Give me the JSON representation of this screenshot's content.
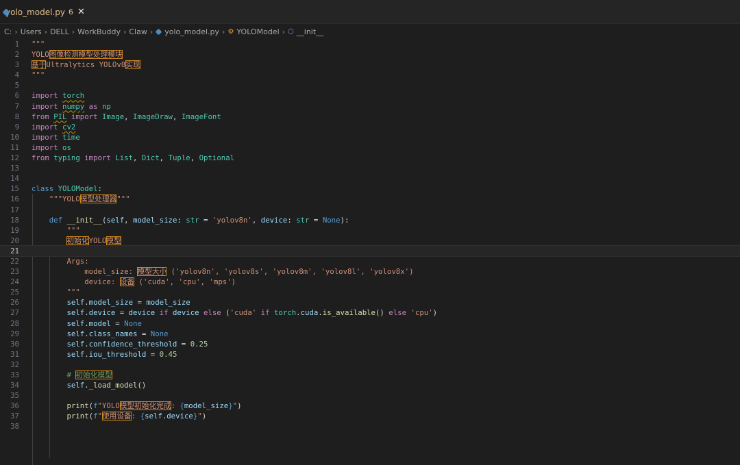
{
  "tab": {
    "filename": "yolo_model.py",
    "problem_count": "6",
    "close_glyph": "✕",
    "icon": "python-file-icon"
  },
  "breadcrumb": {
    "drive": "C:",
    "parts": [
      "Users",
      "DELL",
      "WorkBuddy",
      "Claw"
    ],
    "file": "yolo_model.py",
    "class_name": "YOLOModel",
    "method": "__init__"
  },
  "colors": {
    "keyword": "#c586c0",
    "builtin_keyword": "#569cd6",
    "function": "#dcdcaa",
    "class": "#4ec9b0",
    "string": "#ce9178",
    "number": "#b5cea8",
    "variable": "#9cdcfe",
    "comment": "#6a9955",
    "highlight_box": "#d18616"
  },
  "current_line": 21,
  "lines": [
    [
      [
        "str",
        "\"\"\""
      ]
    ],
    [
      [
        "str",
        "YOLO"
      ],
      [
        "str cjk",
        "图像检测模型处理模块"
      ]
    ],
    [
      [
        "str cjk",
        "基于"
      ],
      [
        "str",
        "Ultralytics YOLOv8"
      ],
      [
        "str cjk",
        "实现"
      ]
    ],
    [
      [
        "str",
        "\"\"\""
      ]
    ],
    [],
    [
      [
        "kw",
        "import "
      ],
      [
        "cls squig",
        "torch"
      ]
    ],
    [
      [
        "kw",
        "import "
      ],
      [
        "cls squig",
        "numpy"
      ],
      [
        "kw",
        " as "
      ],
      [
        "cls",
        "np"
      ]
    ],
    [
      [
        "kw",
        "from "
      ],
      [
        "cls squig",
        "PIL"
      ],
      [
        "kw",
        " import "
      ],
      [
        "cls",
        "Image"
      ],
      [
        "plain",
        ", "
      ],
      [
        "cls",
        "ImageDraw"
      ],
      [
        "plain",
        ", "
      ],
      [
        "cls",
        "ImageFont"
      ]
    ],
    [
      [
        "kw",
        "import "
      ],
      [
        "cls squig",
        "cv2"
      ]
    ],
    [
      [
        "kw",
        "import "
      ],
      [
        "cls",
        "time"
      ]
    ],
    [
      [
        "kw",
        "import "
      ],
      [
        "cls",
        "os"
      ]
    ],
    [
      [
        "kw",
        "from "
      ],
      [
        "cls",
        "typing"
      ],
      [
        "kw",
        " import "
      ],
      [
        "cls",
        "List"
      ],
      [
        "plain",
        ", "
      ],
      [
        "cls",
        "Dict"
      ],
      [
        "plain",
        ", "
      ],
      [
        "cls",
        "Tuple"
      ],
      [
        "plain",
        ", "
      ],
      [
        "cls",
        "Optional"
      ]
    ],
    [],
    [],
    [
      [
        "kwb",
        "class "
      ],
      [
        "cls",
        "YOLOModel"
      ],
      [
        "plain",
        ":"
      ]
    ],
    [
      [
        "plain",
        "    "
      ],
      [
        "str",
        "\"\"\"YOLO"
      ],
      [
        "str cjk",
        "模型处理器"
      ],
      [
        "str",
        "\"\"\""
      ]
    ],
    [],
    [
      [
        "plain",
        "    "
      ],
      [
        "kwb",
        "def "
      ],
      [
        "fn",
        "__init__"
      ],
      [
        "plain",
        "("
      ],
      [
        "self",
        "self"
      ],
      [
        "plain",
        ", "
      ],
      [
        "var",
        "model_size"
      ],
      [
        "plain",
        ": "
      ],
      [
        "cls",
        "str"
      ],
      [
        "plain",
        " = "
      ],
      [
        "str",
        "'yolov8n'"
      ],
      [
        "plain",
        ", "
      ],
      [
        "var",
        "device"
      ],
      [
        "plain",
        ": "
      ],
      [
        "cls",
        "str"
      ],
      [
        "plain",
        " = "
      ],
      [
        "kwb",
        "None"
      ],
      [
        "plain",
        "):"
      ]
    ],
    [
      [
        "plain",
        "        "
      ],
      [
        "str",
        "\"\"\""
      ]
    ],
    [
      [
        "plain",
        "        "
      ],
      [
        "str cjk",
        "初始化"
      ],
      [
        "str",
        "YOLO"
      ],
      [
        "str cjk",
        "模型"
      ]
    ],
    [],
    [
      [
        "plain",
        "        "
      ],
      [
        "str",
        "Args:"
      ]
    ],
    [
      [
        "plain",
        "            "
      ],
      [
        "str",
        "model_size: "
      ],
      [
        "str cjk",
        "模型大小"
      ],
      [
        "str",
        " ('yolov8n', 'yolov8s', 'yolov8m', 'yolov8l', 'yolov8x')"
      ]
    ],
    [
      [
        "plain",
        "            "
      ],
      [
        "str",
        "device: "
      ],
      [
        "str cjk",
        "设备"
      ],
      [
        "str",
        " ('cuda', 'cpu', 'mps')"
      ]
    ],
    [
      [
        "plain",
        "        "
      ],
      [
        "str",
        "\"\"\""
      ]
    ],
    [
      [
        "plain",
        "        "
      ],
      [
        "self",
        "self"
      ],
      [
        "plain",
        "."
      ],
      [
        "var",
        "model_size"
      ],
      [
        "plain",
        " = "
      ],
      [
        "var",
        "model_size"
      ]
    ],
    [
      [
        "plain",
        "        "
      ],
      [
        "self",
        "self"
      ],
      [
        "plain",
        "."
      ],
      [
        "var",
        "device"
      ],
      [
        "plain",
        " = "
      ],
      [
        "var",
        "device"
      ],
      [
        "kw",
        " if "
      ],
      [
        "var",
        "device"
      ],
      [
        "kw",
        " else "
      ],
      [
        "plain",
        "("
      ],
      [
        "str",
        "'cuda'"
      ],
      [
        "kw",
        " if "
      ],
      [
        "cls",
        "torch"
      ],
      [
        "plain",
        "."
      ],
      [
        "var",
        "cuda"
      ],
      [
        "plain",
        "."
      ],
      [
        "fn",
        "is_available"
      ],
      [
        "plain",
        "()"
      ],
      [
        "kw",
        " else "
      ],
      [
        "str",
        "'cpu'"
      ],
      [
        "plain",
        ")"
      ]
    ],
    [
      [
        "plain",
        "        "
      ],
      [
        "self",
        "self"
      ],
      [
        "plain",
        "."
      ],
      [
        "var",
        "model"
      ],
      [
        "plain",
        " = "
      ],
      [
        "kwb",
        "None"
      ]
    ],
    [
      [
        "plain",
        "        "
      ],
      [
        "self",
        "self"
      ],
      [
        "plain",
        "."
      ],
      [
        "var",
        "class_names"
      ],
      [
        "plain",
        " = "
      ],
      [
        "kwb",
        "None"
      ]
    ],
    [
      [
        "plain",
        "        "
      ],
      [
        "self",
        "self"
      ],
      [
        "plain",
        "."
      ],
      [
        "var",
        "confidence_threshold"
      ],
      [
        "plain",
        " = "
      ],
      [
        "num",
        "0.25"
      ]
    ],
    [
      [
        "plain",
        "        "
      ],
      [
        "self",
        "self"
      ],
      [
        "plain",
        "."
      ],
      [
        "var",
        "iou_threshold"
      ],
      [
        "plain",
        " = "
      ],
      [
        "num",
        "0.45"
      ]
    ],
    [],
    [
      [
        "plain",
        "        "
      ],
      [
        "com",
        "# "
      ],
      [
        "com cjk",
        "初始化模型"
      ]
    ],
    [
      [
        "plain",
        "        "
      ],
      [
        "self",
        "self"
      ],
      [
        "plain",
        "."
      ],
      [
        "fn",
        "_load_model"
      ],
      [
        "plain",
        "()"
      ]
    ],
    [],
    [
      [
        "plain",
        "        "
      ],
      [
        "fn",
        "print"
      ],
      [
        "plain",
        "("
      ],
      [
        "kwb",
        "f"
      ],
      [
        "str",
        "\"YOLO"
      ],
      [
        "str cjk",
        "模型初始化完成"
      ],
      [
        "str",
        ": "
      ],
      [
        "kwb",
        "{"
      ],
      [
        "var",
        "model_size"
      ],
      [
        "kwb",
        "}"
      ],
      [
        "str",
        "\""
      ],
      [
        "plain",
        ")"
      ]
    ],
    [
      [
        "plain",
        "        "
      ],
      [
        "fn",
        "print"
      ],
      [
        "plain",
        "("
      ],
      [
        "kwb",
        "f"
      ],
      [
        "str",
        "\""
      ],
      [
        "str cjk",
        "使用设备"
      ],
      [
        "str",
        ": "
      ],
      [
        "kwb",
        "{"
      ],
      [
        "self",
        "self"
      ],
      [
        "plain",
        "."
      ],
      [
        "var",
        "device"
      ],
      [
        "kwb",
        "}"
      ],
      [
        "str",
        "\""
      ],
      [
        "plain",
        ")"
      ]
    ],
    []
  ]
}
